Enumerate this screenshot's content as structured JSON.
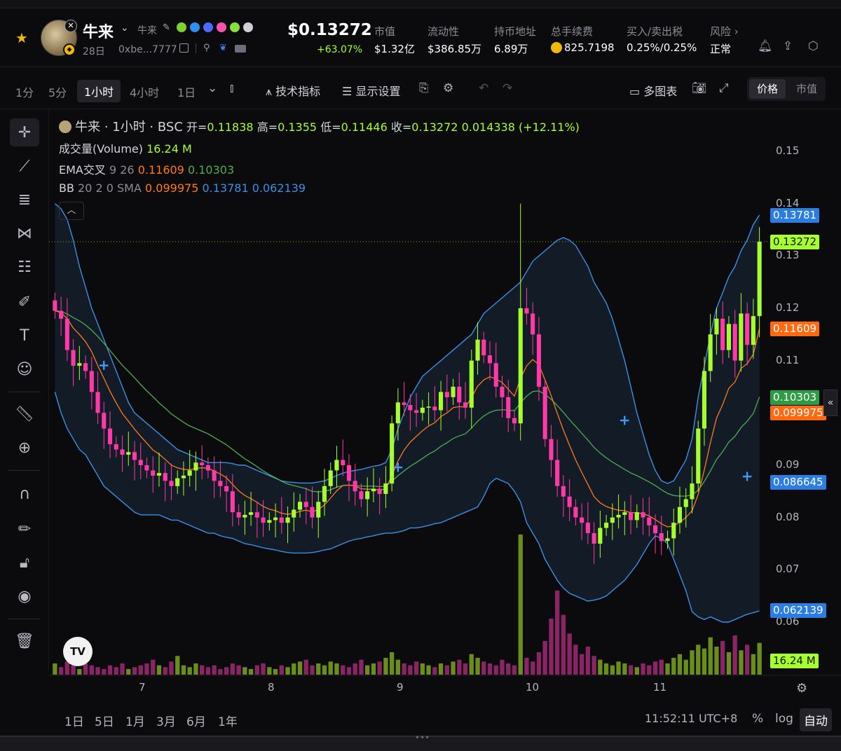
{
  "token": {
    "name": "牛来",
    "sub": "牛来",
    "age": "28日",
    "address": "0xbe...7777",
    "price": "$0.13272",
    "change": "+63.07%"
  },
  "stats": [
    {
      "label": "市值",
      "value": "$1.32亿"
    },
    {
      "label": "流动性",
      "value": "$386.85万"
    },
    {
      "label": "持币地址",
      "value": "6.89万"
    },
    {
      "label": "总手续费",
      "value": "825.7198"
    },
    {
      "label": "买入/卖出税",
      "value": "0.25%/0.25%"
    },
    {
      "label": "风险 ›",
      "value": "正常"
    }
  ],
  "toolbar": {
    "timeframes": [
      "1分",
      "5分",
      "1小时",
      "4小时",
      "1日"
    ],
    "active_timeframe": "1小时",
    "indicators": "技术指标",
    "display": "显示设置",
    "multi_chart": "多图表",
    "price_tab": "价格",
    "mcap_tab": "市值"
  },
  "legend": {
    "title": "牛来 · 1小时 · BSC",
    "ohlc": {
      "open_lbl": "开=",
      "open": "0.11838",
      "high_lbl": "高=",
      "high": "0.1355",
      "low_lbl": "低=",
      "low": "0.11446",
      "close_lbl": "收=",
      "close": "0.13272",
      "change": "0.014338 (+12.11%)"
    },
    "volume_lbl": "成交量(Volume)",
    "volume": "16.24 M",
    "ema_lbl": "EMA交叉",
    "ema_params": "9 26",
    "ema_fast": "0.11609",
    "ema_slow": "0.10303",
    "bb_lbl": "BB",
    "bb_params": "20 2 0 SMA",
    "bb_mid": "0.099975",
    "bb_upper": "0.13781",
    "bb_lower": "0.062139"
  },
  "axis": {
    "y_ticks": [
      "0.15",
      "0.14",
      "0.13",
      "0.12",
      "0.11",
      "0.10",
      "0.09",
      "0.08",
      "0.07",
      "0.06"
    ],
    "x_ticks": [
      "7",
      "8",
      "9",
      "10",
      "11"
    ]
  },
  "price_tags": {
    "bb_upper": "0.13781",
    "last": "0.13272",
    "ema_fast": "0.11609",
    "ema_slow": "0.10303",
    "bb_mid": "0.099975",
    "low_mark": "0.086645",
    "bb_lower": "0.062139",
    "volume": "16.24 M"
  },
  "bottom": {
    "ranges": [
      "1日",
      "5日",
      "1月",
      "3月",
      "6月",
      "1年"
    ],
    "clock": "11:52:11 UTC+8",
    "pct": "%",
    "log": "log",
    "auto": "自动"
  },
  "colors": {
    "up": "#a6ff2f",
    "down": "#ff3aa8",
    "ema_fast": "#ff7a1a",
    "ema_slow": "#4caf50",
    "bb": "#3b8fe8"
  },
  "chart_data": {
    "type": "candlestick",
    "title": "牛来 · 1小时 · BSC",
    "ylim": [
      0.055,
      0.155
    ],
    "x_ticks": [
      "7",
      "8",
      "9",
      "10",
      "11"
    ],
    "ohlc_last": {
      "open": 0.11838,
      "high": 0.1355,
      "low": 0.11446,
      "close": 0.13272
    },
    "close_series": [
      0.1195,
      0.118,
      0.112,
      0.109,
      0.1095,
      0.108,
      0.104,
      0.1,
      0.097,
      0.094,
      0.093,
      0.092,
      0.0925,
      0.091,
      0.09,
      0.089,
      0.088,
      0.0885,
      0.087,
      0.086,
      0.0875,
      0.088,
      0.089,
      0.0905,
      0.09,
      0.089,
      0.087,
      0.086,
      0.085,
      0.081,
      0.08,
      0.0805,
      0.081,
      0.08,
      0.079,
      0.0795,
      0.08,
      0.079,
      0.08,
      0.0815,
      0.083,
      0.082,
      0.08,
      0.083,
      0.086,
      0.089,
      0.091,
      0.09,
      0.087,
      0.085,
      0.0835,
      0.085,
      0.0855,
      0.0845,
      0.0865,
      0.098,
      0.102,
      0.1015,
      0.1005,
      0.1,
      0.101,
      0.1012,
      0.1005,
      0.104,
      0.103,
      0.105,
      0.102,
      0.101,
      0.11,
      0.114,
      0.111,
      0.1095,
      0.105,
      0.103,
      0.099,
      0.098,
      0.12,
      0.119,
      0.115,
      0.105,
      0.095,
      0.091,
      0.086,
      0.084,
      0.082,
      0.08,
      0.079,
      0.077,
      0.075,
      0.078,
      0.079,
      0.08,
      0.0805,
      0.081,
      0.0795,
      0.081,
      0.08,
      0.0785,
      0.077,
      0.0755,
      0.076,
      0.079,
      0.082,
      0.0835,
      0.0865,
      0.097,
      0.108,
      0.115,
      0.118,
      0.112,
      0.117,
      0.11,
      0.119,
      0.113,
      0.1185,
      0.13272
    ],
    "ema_fast": [
      0.1195,
      0.1192,
      0.118,
      0.1162,
      0.115,
      0.1136,
      0.1117,
      0.109,
      0.1066,
      0.1041,
      0.1019,
      0.0999,
      0.0984,
      0.0969,
      0.0955,
      0.0942,
      0.0929,
      0.0921,
      0.0911,
      0.09,
      0.0895,
      0.0892,
      0.0891,
      0.0894,
      0.0895,
      0.0894,
      0.0889,
      0.0883,
      0.0876,
      0.0863,
      0.0851,
      0.0842,
      0.0836,
      0.0829,
      0.0821,
      0.0816,
      0.0813,
      0.0808,
      0.0806,
      0.0808,
      0.0812,
      0.0814,
      0.0811,
      0.0815,
      0.0824,
      0.0837,
      0.0851,
      0.0861,
      0.0862,
      0.086,
      0.0855,
      0.0854,
      0.0854,
      0.0852,
      0.0855,
      0.088,
      0.0908,
      0.0929,
      0.0944,
      0.0955,
      0.0966,
      0.0975,
      0.0981,
      0.0993,
      0.1,
      0.101,
      0.1012,
      0.1011,
      0.1029,
      0.1051,
      0.1063,
      0.1069,
      0.1065,
      0.1058,
      0.1045,
      0.1032,
      0.1066,
      0.109,
      0.1102,
      0.1092,
      0.1063,
      0.1033,
      0.0999,
      0.0967,
      0.0938,
      0.091,
      0.0886,
      0.0863,
      0.084,
      0.0828,
      0.0821,
      0.0817,
      0.0814,
      0.0813,
      0.0809,
      0.0809,
      0.0807,
      0.0803,
      0.0796,
      0.0788,
      0.0782,
      0.0784,
      0.0791,
      0.08,
      0.0813,
      0.0844,
      0.0891,
      0.0943,
      0.099,
      0.1016,
      0.1047,
      0.1059,
      0.1085,
      0.1094,
      0.1112,
      0.11609
    ],
    "ema_slow": [
      0.1195,
      0.1194,
      0.1189,
      0.1182,
      0.1176,
      0.1168,
      0.1158,
      0.1146,
      0.1133,
      0.1119,
      0.1105,
      0.1091,
      0.1079,
      0.1067,
      0.1054,
      0.1042,
      0.1031,
      0.1019,
      0.1009,
      0.0998,
      0.099,
      0.0982,
      0.0975,
      0.097,
      0.0965,
      0.096,
      0.0953,
      0.0946,
      0.0939,
      0.093,
      0.0921,
      0.0912,
      0.0905,
      0.0897,
      0.0889,
      0.0882,
      0.0876,
      0.0869,
      0.0864,
      0.0861,
      0.0858,
      0.0855,
      0.085,
      0.0849,
      0.085,
      0.0853,
      0.0858,
      0.0861,
      0.0862,
      0.0861,
      0.086,
      0.086,
      0.086,
      0.0859,
      0.086,
      0.0869,
      0.088,
      0.0889,
      0.0898,
      0.0905,
      0.0913,
      0.0921,
      0.0927,
      0.0936,
      0.0943,
      0.0951,
      0.0956,
      0.096,
      0.0971,
      0.0984,
      0.0994,
      0.1001,
      0.1005,
      0.1006,
      0.1005,
      0.1004,
      0.1019,
      0.1032,
      0.1041,
      0.1042,
      0.1035,
      0.1026,
      0.1014,
      0.1001,
      0.0987,
      0.0974,
      0.0961,
      0.0948,
      0.0934,
      0.0923,
      0.0914,
      0.0906,
      0.0899,
      0.0892,
      0.0885,
      0.088,
      0.0874,
      0.0868,
      0.0861,
      0.0853,
      0.0846,
      0.0842,
      0.0841,
      0.0841,
      0.0843,
      0.0852,
      0.0869,
      0.0889,
      0.0911,
      0.0926,
      0.0944,
      0.0955,
      0.0972,
      0.0984,
      0.0999,
      0.10303
    ],
    "bb_upper": [
      0.14,
      0.139,
      0.137,
      0.133,
      0.128,
      0.124,
      0.12,
      0.117,
      0.114,
      0.111,
      0.108,
      0.105,
      0.102,
      0.1,
      0.099,
      0.098,
      0.097,
      0.096,
      0.095,
      0.094,
      0.093,
      0.0925,
      0.092,
      0.0915,
      0.091,
      0.0905,
      0.0905,
      0.0905,
      0.0905,
      0.0903,
      0.09,
      0.09,
      0.0895,
      0.089,
      0.0885,
      0.088,
      0.0875,
      0.087,
      0.0868,
      0.0867,
      0.0866,
      0.0866,
      0.0866,
      0.0868,
      0.087,
      0.0875,
      0.088,
      0.0885,
      0.0888,
      0.089,
      0.0892,
      0.0895,
      0.0898,
      0.09,
      0.0905,
      0.093,
      0.097,
      0.1,
      0.103,
      0.105,
      0.107,
      0.108,
      0.109,
      0.11,
      0.111,
      0.112,
      0.113,
      0.114,
      0.115,
      0.117,
      0.119,
      0.12,
      0.121,
      0.122,
      0.123,
      0.124,
      0.125,
      0.127,
      0.129,
      0.13,
      0.131,
      0.132,
      0.133,
      0.1335,
      0.133,
      0.132,
      0.13,
      0.128,
      0.125,
      0.123,
      0.121,
      0.118,
      0.114,
      0.11,
      0.105,
      0.1,
      0.096,
      0.092,
      0.089,
      0.087,
      0.0865,
      0.087,
      0.089,
      0.091,
      0.095,
      0.103,
      0.109,
      0.115,
      0.12,
      0.123,
      0.126,
      0.128,
      0.131,
      0.133,
      0.136,
      0.13781
    ],
    "bb_lower": [
      0.104,
      0.1,
      0.097,
      0.095,
      0.093,
      0.092,
      0.09,
      0.088,
      0.086,
      0.085,
      0.084,
      0.083,
      0.082,
      0.081,
      0.0805,
      0.0805,
      0.0805,
      0.0805,
      0.08,
      0.0795,
      0.0795,
      0.079,
      0.0785,
      0.078,
      0.0775,
      0.077,
      0.077,
      0.0765,
      0.0762,
      0.076,
      0.0755,
      0.075,
      0.0748,
      0.0745,
      0.0742,
      0.074,
      0.0738,
      0.0735,
      0.0733,
      0.0732,
      0.0732,
      0.0732,
      0.0733,
      0.0735,
      0.0738,
      0.074,
      0.0745,
      0.075,
      0.0755,
      0.0758,
      0.076,
      0.0763,
      0.0765,
      0.0768,
      0.077,
      0.077,
      0.0772,
      0.0775,
      0.078,
      0.078,
      0.0782,
      0.0785,
      0.0788,
      0.079,
      0.0795,
      0.08,
      0.0805,
      0.081,
      0.0815,
      0.082,
      0.084,
      0.0865,
      0.0875,
      0.087,
      0.0865,
      0.085,
      0.083,
      0.079,
      0.077,
      0.075,
      0.072,
      0.07,
      0.068,
      0.0665,
      0.0655,
      0.065,
      0.0645,
      0.064,
      0.0642,
      0.0645,
      0.065,
      0.066,
      0.067,
      0.068,
      0.0695,
      0.071,
      0.073,
      0.075,
      0.0765,
      0.076,
      0.075,
      0.072,
      0.069,
      0.066,
      0.062,
      0.061,
      0.0605,
      0.061,
      0.0605,
      0.06,
      0.06,
      0.0605,
      0.061,
      0.0615,
      0.0618,
      0.062139
    ],
    "volume": [
      0.6,
      0.4,
      0.7,
      0.5,
      0.3,
      0.6,
      0.5,
      0.4,
      0.3,
      0.5,
      0.4,
      0.6,
      0.3,
      0.4,
      0.5,
      0.6,
      0.8,
      0.5,
      0.4,
      0.7,
      1.0,
      0.5,
      0.4,
      0.6,
      0.5,
      0.4,
      0.5,
      0.3,
      0.4,
      0.6,
      0.5,
      0.4,
      0.3,
      0.5,
      0.6,
      0.4,
      0.3,
      0.5,
      0.4,
      0.6,
      0.7,
      0.8,
      0.5,
      0.6,
      0.5,
      0.7,
      0.6,
      0.5,
      0.4,
      0.6,
      0.8,
      0.5,
      0.6,
      0.7,
      0.9,
      1.2,
      0.8,
      0.6,
      0.5,
      0.7,
      0.6,
      0.5,
      0.4,
      0.6,
      0.5,
      0.7,
      0.8,
      0.6,
      1.1,
      0.9,
      0.7,
      0.6,
      0.5,
      0.8,
      0.6,
      0.5,
      7.5,
      0.9,
      0.7,
      1.2,
      1.8,
      3.0,
      4.5,
      3.2,
      2.2,
      1.6,
      1.1,
      1.5,
      1.0,
      0.8,
      0.6,
      0.5,
      0.7,
      0.6,
      0.5,
      0.4,
      0.6,
      0.5,
      0.7,
      0.8,
      0.6,
      0.9,
      1.1,
      0.8,
      1.3,
      1.6,
      1.4,
      2.0,
      1.5,
      1.8,
      1.2,
      2.1,
      1.3,
      1.6,
      1.1,
      1.7
    ]
  }
}
